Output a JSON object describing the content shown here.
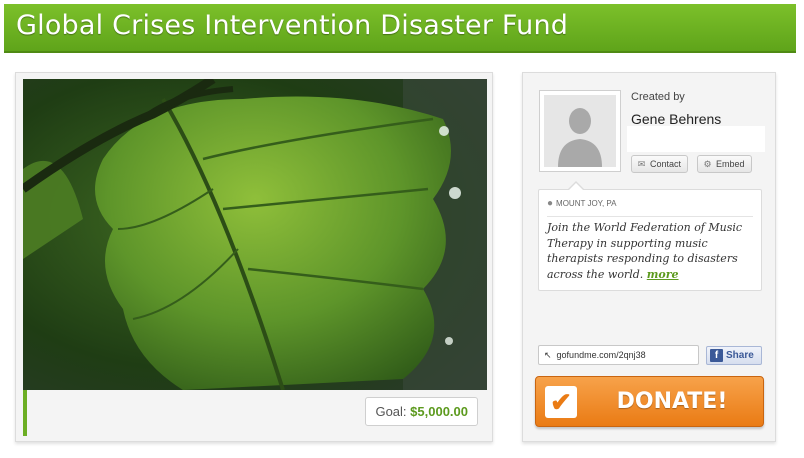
{
  "header": {
    "title": "Global Crises Intervention Disaster Fund"
  },
  "campaign": {
    "image_icon": "leaf-photo",
    "goal_label": "Goal:",
    "goal_amount": "$5,000.00"
  },
  "organizer": {
    "created_by_label": "Created by",
    "name": "Gene Behrens",
    "avatar_icon": "person-silhouette-icon",
    "contact_label": "Contact",
    "contact_icon": "envelope-icon",
    "embed_label": "Embed",
    "embed_icon": "gear-icon"
  },
  "details": {
    "location": "MOUNT JOY, PA",
    "location_icon": "map-pin-icon",
    "description": "Join the World Federation of Music Therapy in supporting music therapists responding to disasters across the world.",
    "more_label": "more"
  },
  "share": {
    "url": "gofundme.com/2qnj38",
    "share_label": "Share",
    "facebook_icon": "facebook-icon"
  },
  "donate": {
    "label": "DONATE!",
    "icon": "checkmark-icon"
  },
  "colors": {
    "brand_green": "#6cae24",
    "donate_orange": "#ea7b14",
    "facebook_blue": "#3b5998"
  }
}
